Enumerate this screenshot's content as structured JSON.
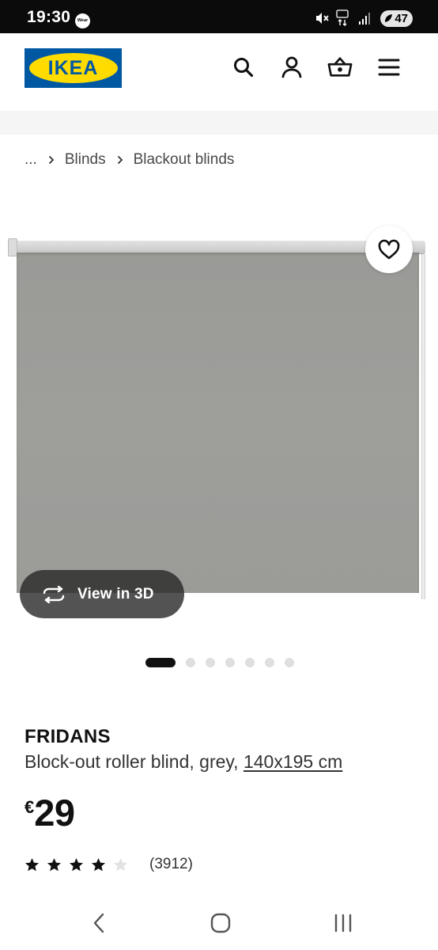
{
  "status_bar": {
    "time": "19:30",
    "wear_badge": "Wear",
    "network": "5G",
    "battery": "47"
  },
  "header": {
    "logo_text": "IKEA",
    "icons": [
      "search-icon",
      "account-icon",
      "basket-icon",
      "menu-icon"
    ]
  },
  "breadcrumb": {
    "items": [
      "...",
      "Blinds",
      "Blackout blinds"
    ]
  },
  "gallery": {
    "view_3d_label": "View in 3D",
    "dot_count": 7,
    "active_dot": 1
  },
  "product": {
    "name": "FRIDANS",
    "description": "Block-out roller blind, grey,",
    "size": "140x195 cm",
    "currency": "€",
    "price": "29",
    "rating_stars": 4,
    "rating_max": 5,
    "review_count": "(3912)"
  },
  "colors": {
    "brand_blue": "#0058a3",
    "brand_yellow": "#ffdb00",
    "blind_grey": "#9c9c99"
  }
}
